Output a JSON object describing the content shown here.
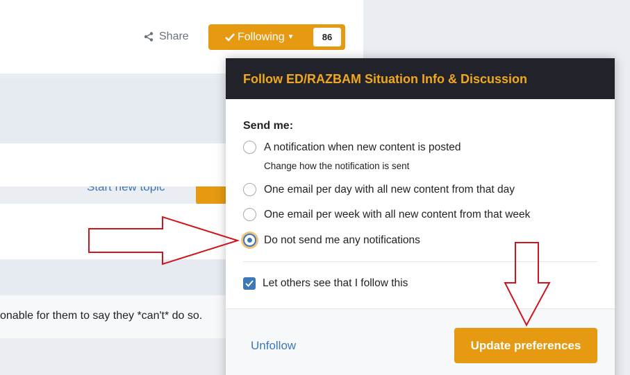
{
  "topic": {
    "share_label": "Share",
    "following_label": "Following",
    "follower_count": "86",
    "start_topic_label": "Start new topic",
    "post_snippet": "onable for them to say they *can't* do so."
  },
  "modal": {
    "title": "Follow ED/RAZBAM Situation Info & Discussion",
    "send_me_label": "Send me:",
    "options": [
      {
        "label": "A notification when new content is posted",
        "checked": false
      },
      {
        "label": "One email per day with all new content from that day",
        "checked": false
      },
      {
        "label": "One email per week with all new content from that week",
        "checked": false
      },
      {
        "label": "Do not send me any notifications",
        "checked": true
      }
    ],
    "change_notification_label": "Change how the notification is sent",
    "let_others_see_label": "Let others see that I follow this",
    "let_others_see_checked": true,
    "unfollow_label": "Unfollow",
    "update_label": "Update preferences"
  },
  "colors": {
    "accent": "#e69a12",
    "link": "#3c78b5",
    "header_bg": "#22232a",
    "header_text": "#f0a81e",
    "annotation_arrow": "#d0141c"
  },
  "icons": {
    "share": "share-icon",
    "following_check": "check-icon",
    "following_caret": "caret-down-icon",
    "checkbox": "check-icon"
  }
}
